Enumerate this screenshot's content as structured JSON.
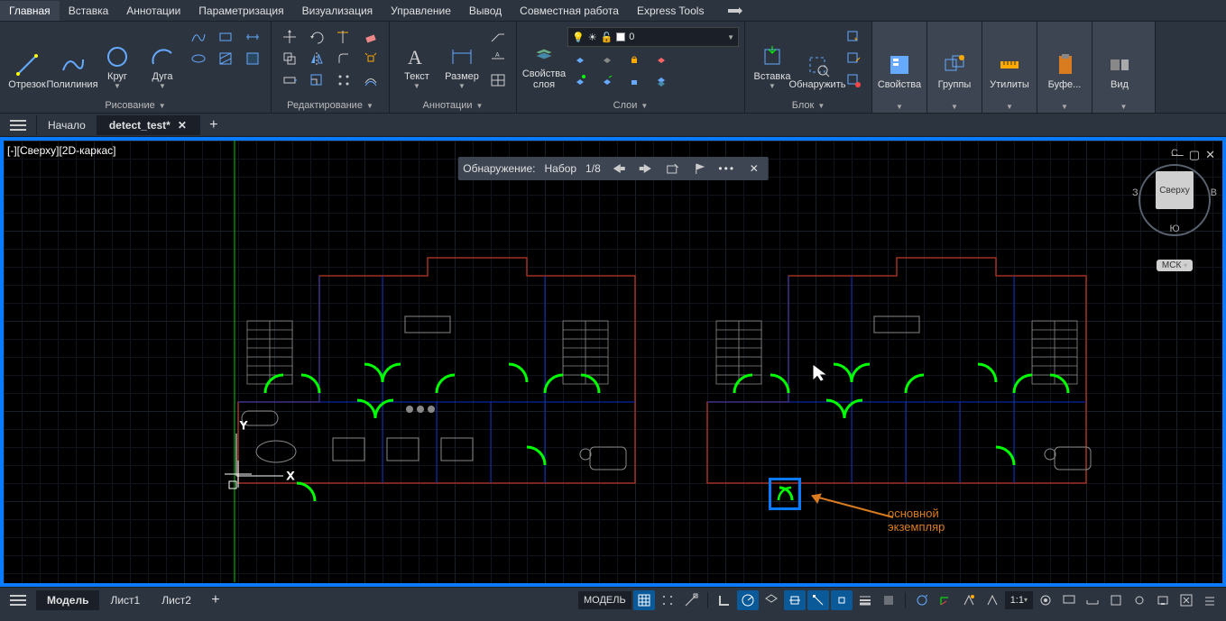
{
  "menu": {
    "items": [
      "Главная",
      "Вставка",
      "Аннотации",
      "Параметризация",
      "Визуализация",
      "Управление",
      "Вывод",
      "Совместная работа",
      "Express Tools"
    ],
    "active": 0
  },
  "ribbon": {
    "panels": {
      "draw": {
        "title": "Рисование",
        "btn_line": "Отрезок",
        "btn_polyline": "Полилиния",
        "btn_circle": "Круг",
        "btn_arc": "Дуга"
      },
      "modify": {
        "title": "Редактирование"
      },
      "annot": {
        "title": "Аннотации",
        "btn_text": "Текст",
        "btn_dim": "Размер"
      },
      "layers": {
        "title": "Слои",
        "btn_props": "Свойства\nслоя",
        "combo_value": "0"
      },
      "block": {
        "title": "Блок",
        "btn_insert": "Вставка",
        "btn_detect": "Обнаружить"
      },
      "props": {
        "title": "Свойства"
      },
      "groups": {
        "title": "Группы"
      },
      "utils": {
        "title": "Утилиты"
      },
      "clip": {
        "title": "Буфе..."
      },
      "view": {
        "title": "Вид"
      }
    }
  },
  "tabs": {
    "start": "Начало",
    "file": "detect_test*"
  },
  "viewport": {
    "label": "[-][Сверху][2D-каркас]"
  },
  "detect_bar": {
    "label": "Обнаружение:",
    "set": "Набор",
    "counter": "1/8"
  },
  "viewcube": {
    "top": "Сверху",
    "n": "С",
    "s": "Ю",
    "w": "З",
    "e": "В",
    "coord": "МСК"
  },
  "annotation": {
    "line1": "основной",
    "line2": "экземпляр"
  },
  "bottom": {
    "model": "Модель",
    "sheet1": "Лист1",
    "sheet2": "Лист2",
    "model_btn": "МОДЕЛЬ",
    "scale": "1:1"
  }
}
